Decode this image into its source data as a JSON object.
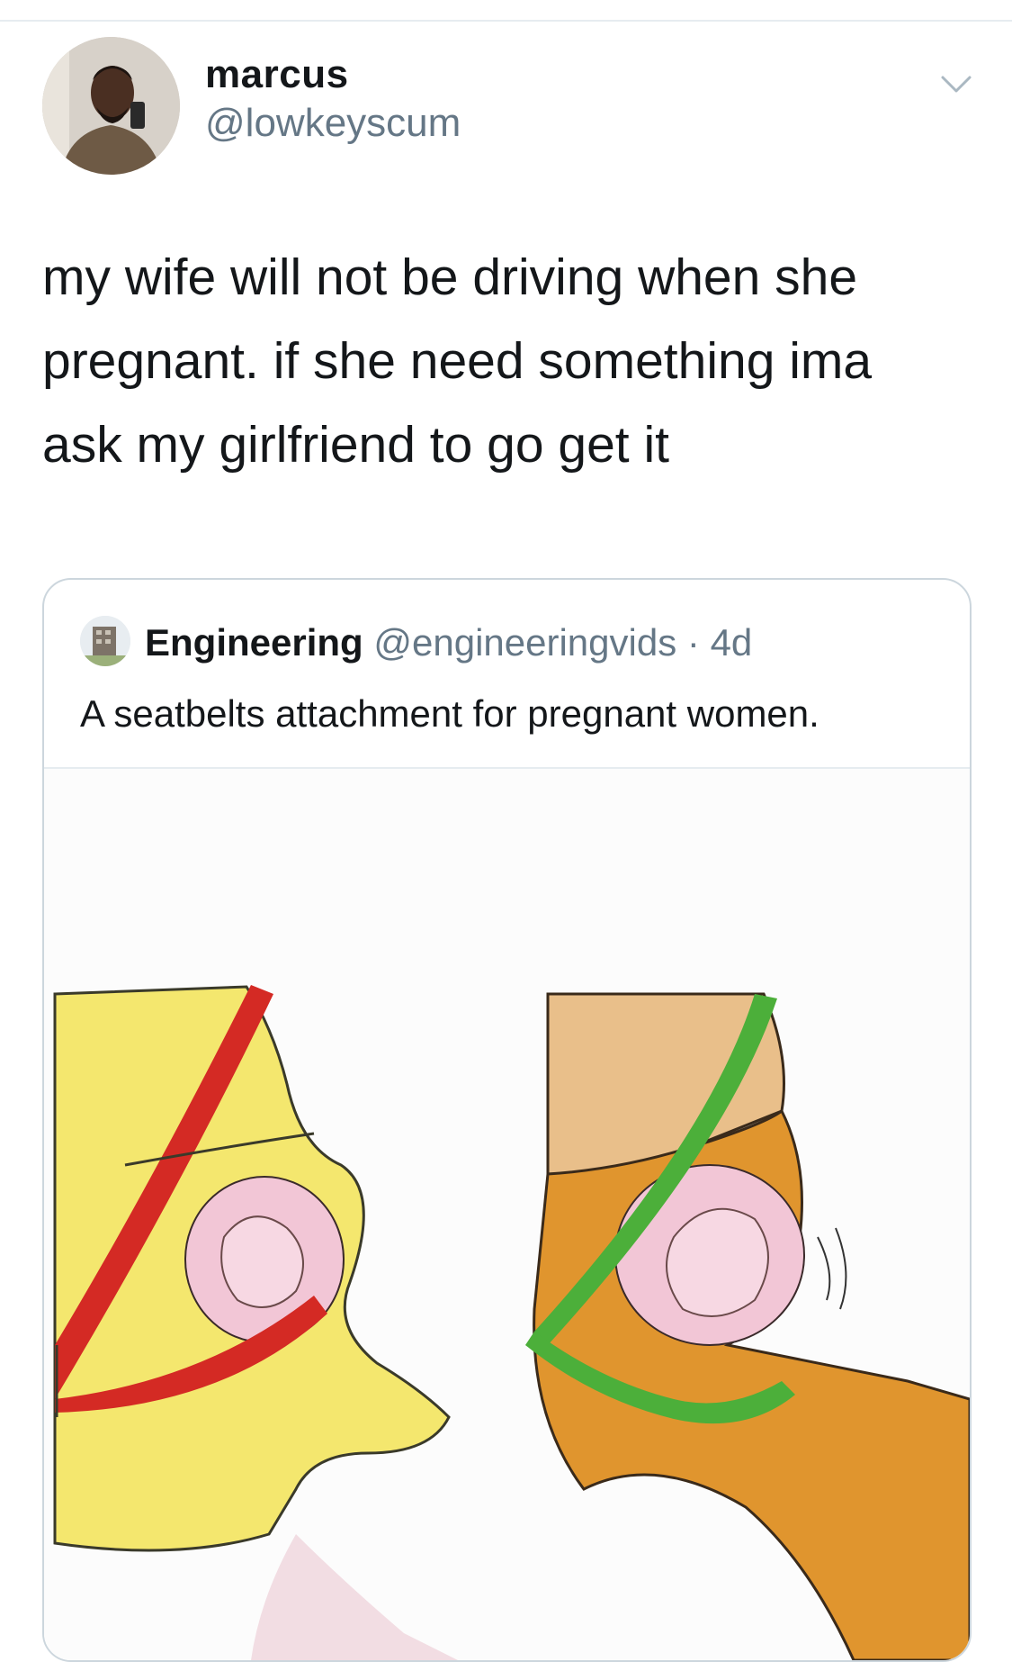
{
  "tweet": {
    "author_name": "marcus",
    "author_handle": "@lowkeyscum",
    "text_lines": [
      "my wife will not be driving when she",
      "pregnant. if she need something ima",
      "ask my girlfriend to go get it"
    ],
    "menu_icon": "chevron-down-icon"
  },
  "quoted": {
    "author_name": "Engineering",
    "author_handle": "@engineeringvids",
    "separator": "·",
    "time": "4d",
    "text": "A seatbelts attachment for pregnant women.",
    "media_description_icon": "seatbelt-illustration"
  },
  "colors": {
    "primary_text": "#14171a",
    "secondary_text": "#657786",
    "border": "#ccd6dd",
    "belt_red": "#d42a24",
    "belt_green": "#4caf3a",
    "body_yellow": "#f3e56b",
    "body_orange": "#e2962f"
  }
}
